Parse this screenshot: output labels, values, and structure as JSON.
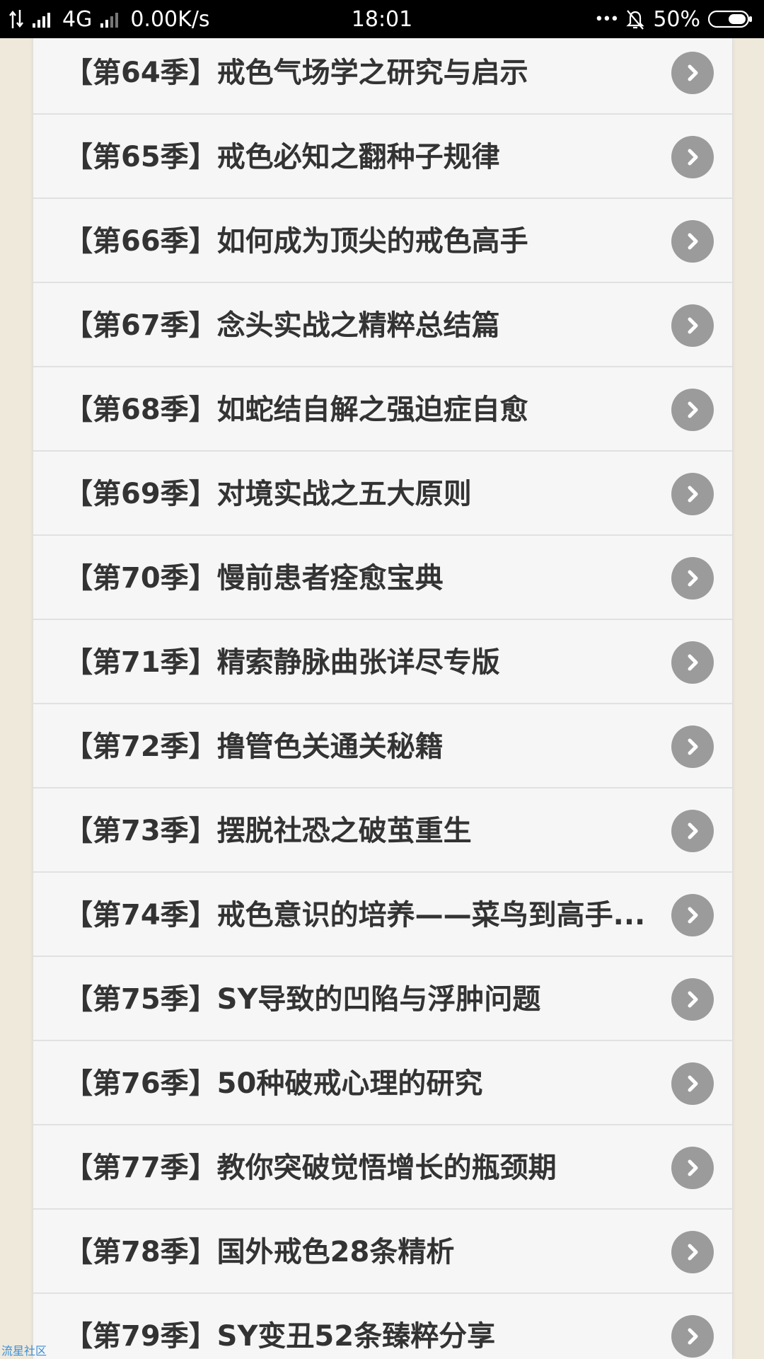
{
  "status_bar": {
    "network": "4G",
    "speed": "0.00K/s",
    "time": "18:01",
    "more": "•••",
    "battery": "50%",
    "battery_level": 0.5
  },
  "list": {
    "items": [
      {
        "title": "【第64季】戒色气场学之研究与启示"
      },
      {
        "title": "【第65季】戒色必知之翻种子规律"
      },
      {
        "title": "【第66季】如何成为顶尖的戒色高手"
      },
      {
        "title": "【第67季】念头实战之精粹总结篇"
      },
      {
        "title": "【第68季】如蛇结自解之强迫症自愈"
      },
      {
        "title": "【第69季】对境实战之五大原则"
      },
      {
        "title": "【第70季】慢前患者痊愈宝典"
      },
      {
        "title": "【第71季】精索静脉曲张详尽专版"
      },
      {
        "title": "【第72季】撸管色关通关秘籍"
      },
      {
        "title": "【第73季】摆脱社恐之破茧重生"
      },
      {
        "title": "【第74季】戒色意识的培养——菜鸟到高手..."
      },
      {
        "title": "【第75季】SY导致的凹陷与浮肿问题"
      },
      {
        "title": "【第76季】50种破戒心理的研究"
      },
      {
        "title": "【第77季】教你突破觉悟增长的瓶颈期"
      },
      {
        "title": "【第78季】国外戒色28条精析"
      },
      {
        "title": "【第79季】SY变丑52条臻粹分享"
      }
    ]
  },
  "watermark": "流星社区"
}
